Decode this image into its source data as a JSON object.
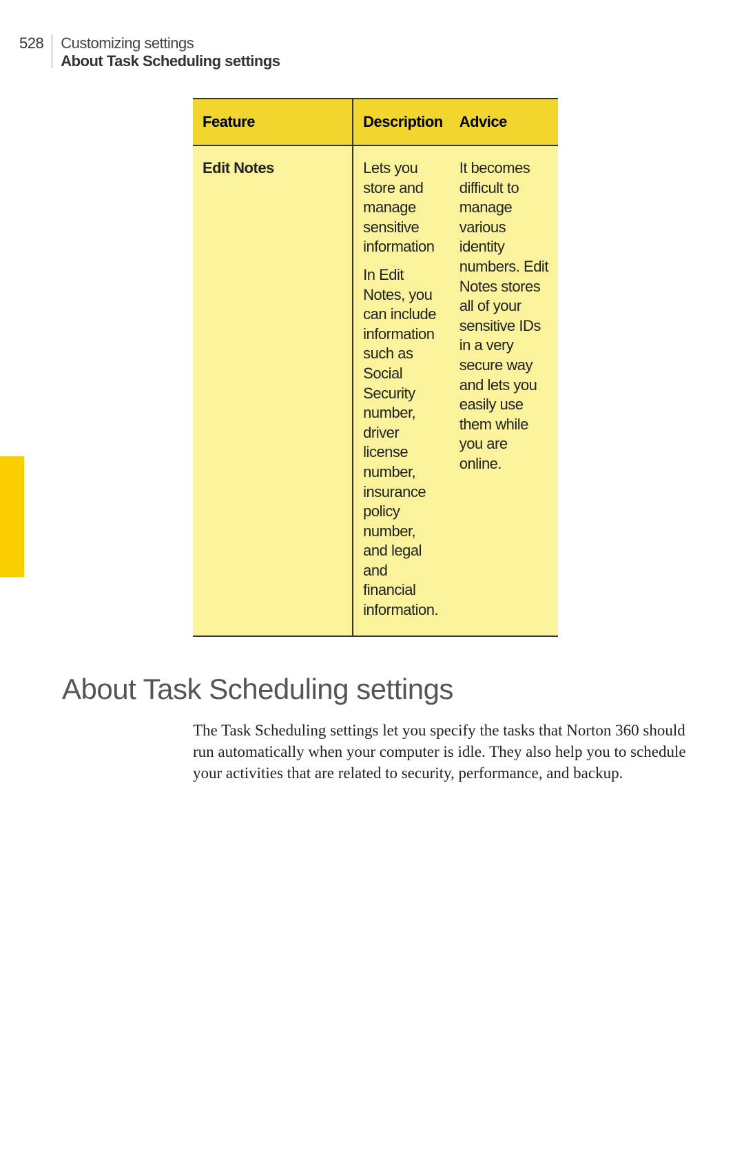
{
  "header": {
    "page_number": "528",
    "chapter": "Customizing settings",
    "section": "About Task Scheduling settings"
  },
  "table": {
    "headers": {
      "feature": "Feature",
      "description": "Description",
      "advice": "Advice"
    },
    "row": {
      "feature": "Edit Notes",
      "description_p1": "Lets you store and manage sensitive information",
      "description_p2": "In Edit Notes, you can include information such as Social Security number, driver license number, insurance policy number, and legal and financial information.",
      "advice": "It becomes difficult to manage various identity numbers. Edit Notes stores all of your sensitive IDs in a very secure way and lets you easily use them while you are online."
    }
  },
  "section_title": "About Task Scheduling settings",
  "body_paragraph": "The Task Scheduling settings let you specify the tasks that Norton 360 should run automatically when your computer is idle. They also help you to schedule your activities that are related to security, performance, and backup."
}
